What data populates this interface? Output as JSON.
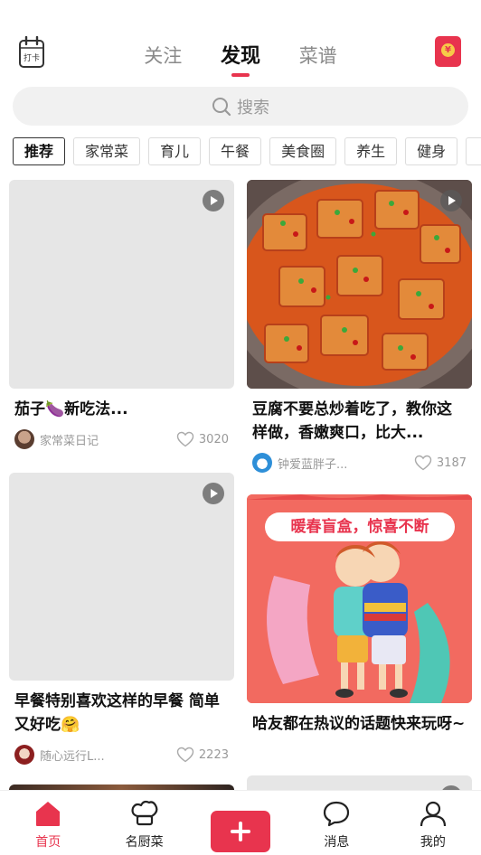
{
  "header": {
    "checkin_label": "打卡",
    "tabs": [
      {
        "label": "关注",
        "active": false
      },
      {
        "label": "发现",
        "active": true
      },
      {
        "label": "菜谱",
        "active": false
      }
    ],
    "redpack_label": "¥"
  },
  "search": {
    "placeholder": "搜索"
  },
  "chips": [
    "推荐",
    "家常菜",
    "育儿",
    "午餐",
    "美食圈",
    "养生",
    "健身"
  ],
  "feed": {
    "left": [
      {
        "title": "茄子🍆新吃法...",
        "author": "家常菜日记",
        "likes": "3020",
        "video": true
      },
      {
        "title": "早餐特别喜欢这样的早餐 简单又好吃🤗",
        "author": "随心远行L...",
        "likes": "2223",
        "video": true
      }
    ],
    "right": [
      {
        "title": "豆腐不要总炒着吃了，教你这样做，香嫩爽口，比大...",
        "author": "钟爱蓝胖子...",
        "likes": "3187",
        "video": true
      },
      {
        "title": "哈友都在热议的话题快来玩呀~",
        "banner_text": "暖春盲盒，惊喜不断",
        "video": false
      }
    ]
  },
  "bottom_nav": [
    {
      "label": "首页",
      "active": true
    },
    {
      "label": "名厨菜",
      "active": false
    },
    {
      "label": "",
      "active": false
    },
    {
      "label": "消息",
      "active": false
    },
    {
      "label": "我的",
      "active": false
    }
  ],
  "colors": {
    "accent": "#e8344e",
    "muted": "#999999",
    "placeholder_bg": "#e6e6e6"
  }
}
